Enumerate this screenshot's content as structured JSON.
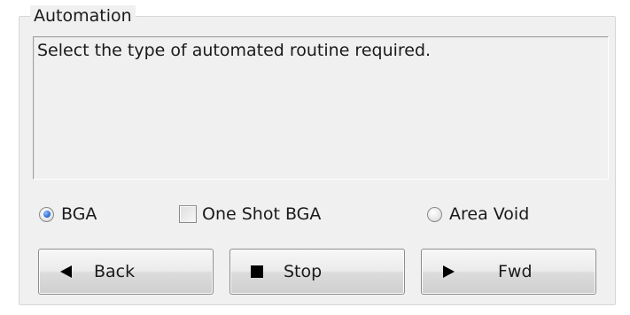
{
  "group": {
    "title": "Automation",
    "description": "Select the type of automated routine required."
  },
  "options": {
    "bga": {
      "label": "BGA",
      "selected": true
    },
    "one_shot_bga": {
      "label": "One Shot BGA",
      "checked": false
    },
    "area_void": {
      "label": "Area Void",
      "selected": false
    }
  },
  "buttons": {
    "back": {
      "label": "Back",
      "icon": "triangle-left-icon"
    },
    "stop": {
      "label": "Stop",
      "icon": "square-stop-icon"
    },
    "fwd": {
      "label": "Fwd",
      "icon": "triangle-right-icon"
    }
  },
  "colors": {
    "panel": "#f0f0f0",
    "radio_selected": "#2f6fd6"
  }
}
